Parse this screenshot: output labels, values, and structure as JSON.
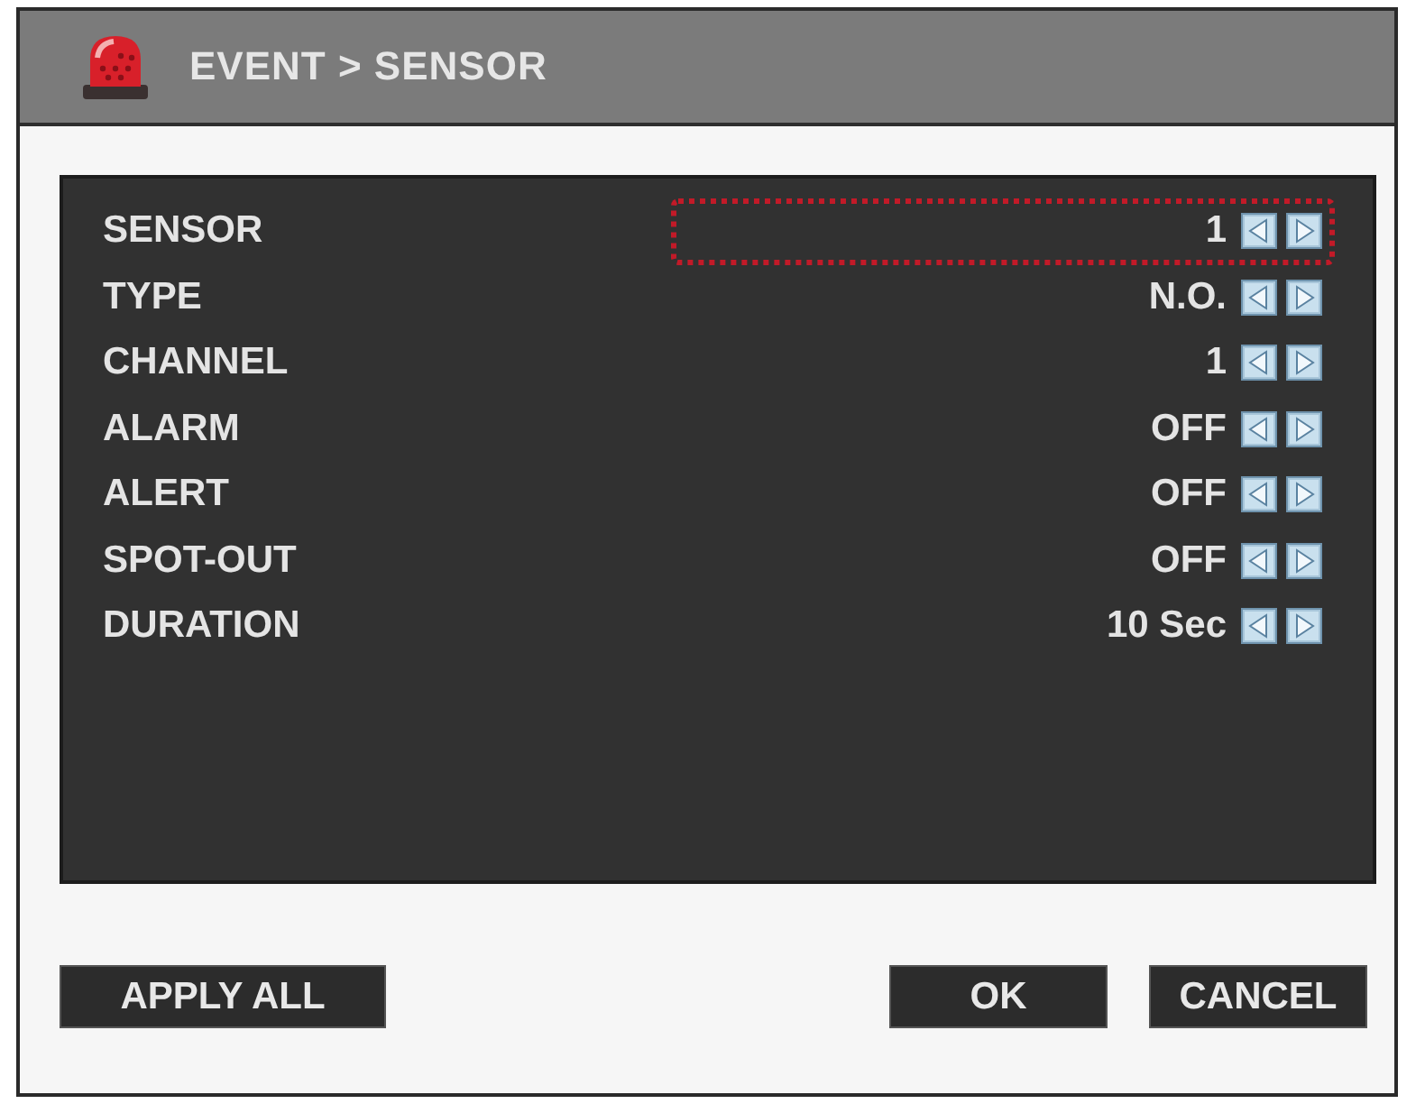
{
  "window": {
    "title": "EVENT > SENSOR"
  },
  "settings": [
    {
      "label": "SENSOR",
      "value": "1",
      "selected": true
    },
    {
      "label": "TYPE",
      "value": "N.O.",
      "selected": false
    },
    {
      "label": "CHANNEL",
      "value": "1",
      "selected": false
    },
    {
      "label": "ALARM",
      "value": "OFF",
      "selected": false
    },
    {
      "label": "ALERT",
      "value": "OFF",
      "selected": false
    },
    {
      "label": "SPOT-OUT",
      "value": "OFF",
      "selected": false
    },
    {
      "label": "DURATION",
      "value": "10 Sec",
      "selected": false
    }
  ],
  "footer": {
    "left_buttons": [
      "APPLY ALL"
    ],
    "right_buttons": [
      "OK",
      "CANCEL"
    ]
  }
}
